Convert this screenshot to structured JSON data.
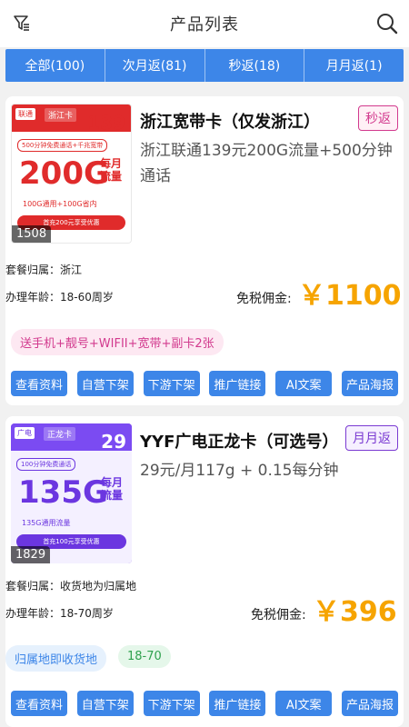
{
  "header": {
    "title": "产品列表",
    "left_icon": "filter-icon",
    "right_icon": "search-icon"
  },
  "tabs": [
    {
      "label": "全部(100)"
    },
    {
      "label": "次月返(81)"
    },
    {
      "label": "秒返(18)"
    },
    {
      "label": "月月返(1)"
    }
  ],
  "colors": {
    "accent": "#3d86e8",
    "commission": "#f6a400"
  },
  "products": [
    {
      "title": "浙江宽带卡（仅发浙江）",
      "badge": "秒返",
      "description": "浙江联通139元200G流量+500分钟通话",
      "thumb": {
        "tag": "联通",
        "name": "浙江卡",
        "price": "139",
        "pill": "500分钟免费通话+千兆宽带",
        "gb": "200G",
        "gb_side": "每月流量",
        "sub": "100G通用+100G省内",
        "promo": "首充200元享受优惠",
        "count": "1508"
      },
      "attribution_label": "套餐归属：",
      "attribution_value": "浙江",
      "age_label": "办理年龄：",
      "age_value": "18-60周岁",
      "commission_label": "免税佣金:",
      "commission_value": "￥1100",
      "chips": [
        "送手机+靓号+WIFII+宽带+副卡2张"
      ],
      "actions": [
        "查看资料",
        "自营下架",
        "下游下架",
        "推广链接",
        "AI文案",
        "产品海报"
      ]
    },
    {
      "title": "YYF广电正龙卡（可选号）",
      "badge": "月月返",
      "description": "29元/月117g + 0.15每分钟",
      "thumb": {
        "tag": "广电",
        "name": "正龙卡",
        "price": "29",
        "pill": "100分钟免费通话",
        "gb": "135G",
        "gb_side": "每月流量",
        "sub": "135G通用流量",
        "promo": "首充100元享受优惠",
        "count": "1829"
      },
      "attribution_label": "套餐归属：",
      "attribution_value": "收货地为归属地",
      "age_label": "办理年龄：",
      "age_value": "18-70周岁",
      "commission_label": "免税佣金:",
      "commission_value": "￥396",
      "chips": [
        "归属地即收货地",
        "18-70"
      ],
      "actions": [
        "查看资料",
        "自营下架",
        "下游下架",
        "推广链接",
        "AI文案",
        "产品海报"
      ]
    }
  ]
}
